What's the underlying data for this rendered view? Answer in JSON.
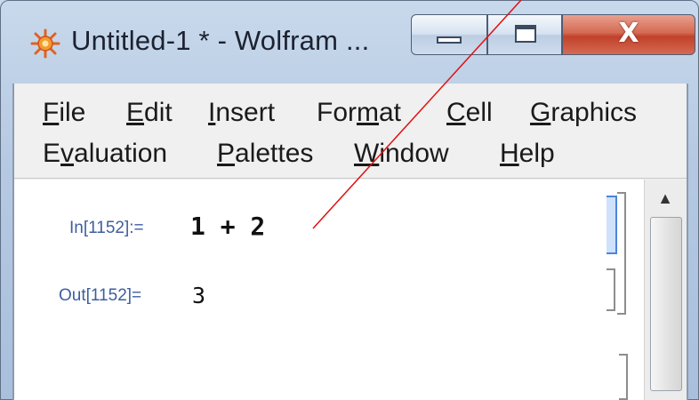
{
  "window": {
    "title": "Untitled-1 * - Wolfram ...",
    "icon": "wolfram-star-icon",
    "close_glyph": "X",
    "accent_close": "#c2412a"
  },
  "menubar": {
    "row1": [
      {
        "pre": "",
        "mn": "F",
        "post": "ile"
      },
      {
        "pre": "",
        "mn": "E",
        "post": "dit"
      },
      {
        "pre": "",
        "mn": "I",
        "post": "nsert"
      },
      {
        "pre": "For",
        "mn": "m",
        "post": "at"
      },
      {
        "pre": "",
        "mn": "C",
        "post": "ell"
      },
      {
        "pre": "",
        "mn": "G",
        "post": "raphics"
      }
    ],
    "row2": [
      {
        "pre": "E",
        "mn": "v",
        "post": "aluation"
      },
      {
        "pre": "",
        "mn": "P",
        "post": "alettes"
      },
      {
        "pre": "",
        "mn": "W",
        "post": "indow"
      },
      {
        "pre": "",
        "mn": "H",
        "post": "elp"
      }
    ]
  },
  "notebook": {
    "input_label": "In[1152]:=",
    "input_expr": "1 + 2",
    "output_label": "Out[1152]=",
    "output_expr": "3"
  },
  "scrollbar": {
    "up_arrow": "▲"
  }
}
